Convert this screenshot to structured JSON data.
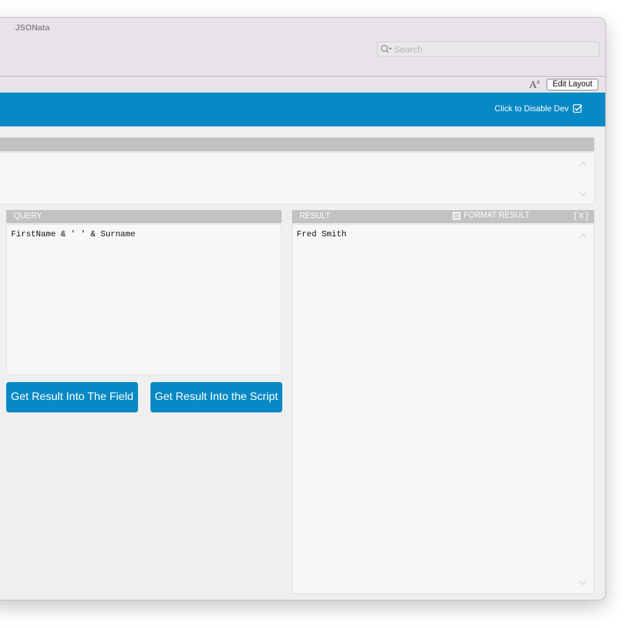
{
  "window": {
    "title": "JSONata"
  },
  "search": {
    "placeholder": "Search",
    "value": ""
  },
  "layout_bar": {
    "font_icon": "A",
    "font_icon_sup": "a",
    "edit_layout_label": "Edit Layout"
  },
  "dev_bar": {
    "toggle_label": "Click to Disable Dev",
    "checked": true
  },
  "query": {
    "header": "QUERY",
    "text": "FirstName & ' ' & Surname"
  },
  "result": {
    "header": "RESULT",
    "format_label": "FORMAT RESULT",
    "close_label": "[X]",
    "text": "Fred Smith"
  },
  "buttons": {
    "into_field": "Get Result Into The Field",
    "into_script": "Get Result Into the Script"
  },
  "colors": {
    "accent": "#0789c5",
    "panel_header": "#c2c2c2",
    "panel_bg": "#f7f7f7",
    "window_bg": "#efefef",
    "titlebar": "#e7e3e9"
  },
  "icons": {
    "search": "search-icon",
    "checkbox": "checkbox-checked-icon",
    "format_checkbox": "checkbox-x-icon",
    "scroll_up": "chevron-up-icon",
    "scroll_down": "chevron-down-icon",
    "font_size": "font-size-icon"
  }
}
